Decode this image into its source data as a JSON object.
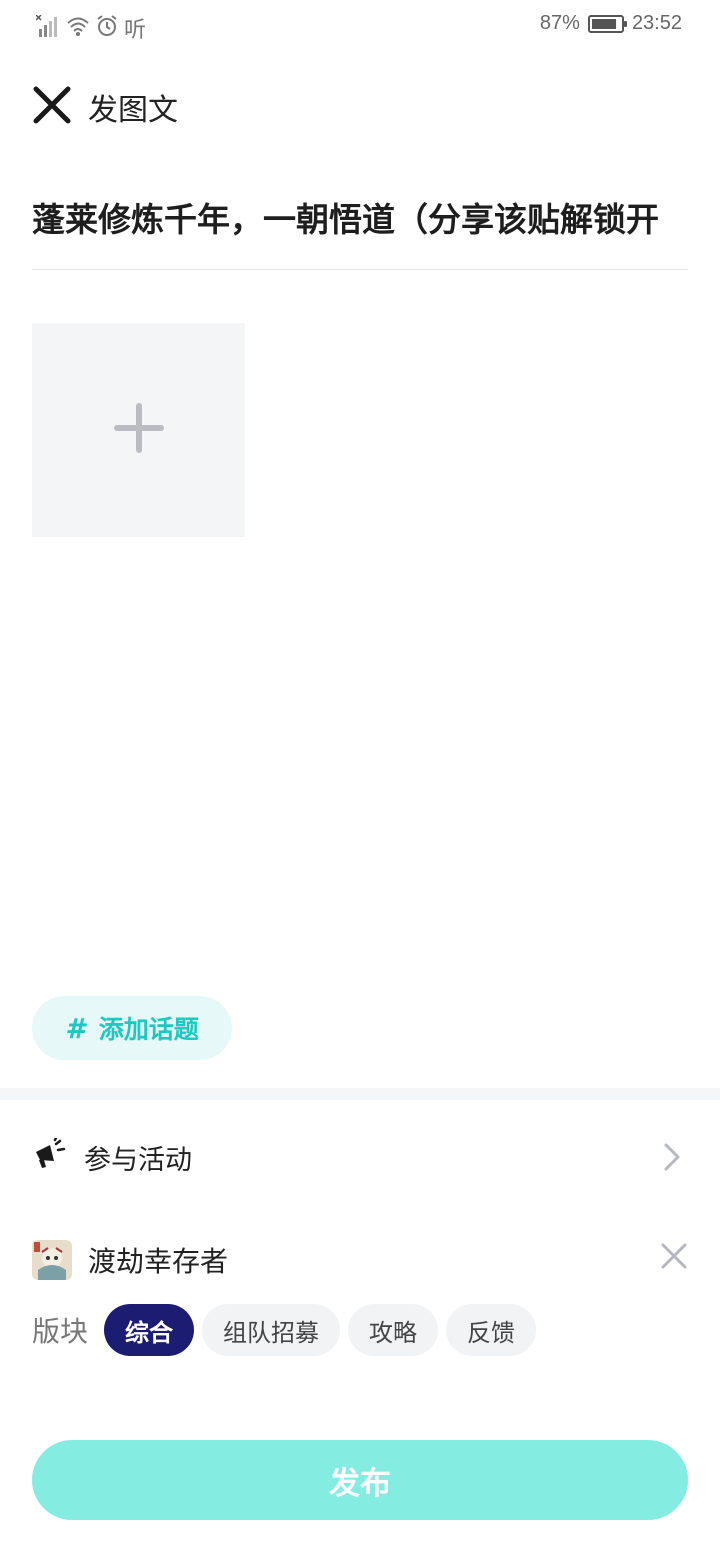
{
  "status_bar": {
    "battery_text": "87%",
    "battery_level": 0.87,
    "time": "23:52",
    "listen_text": "听",
    "icons": [
      "signal-icon",
      "wifi-icon",
      "alarm-icon"
    ]
  },
  "header": {
    "title": "发图文",
    "close_icon": "close-icon"
  },
  "post": {
    "title": "蓬莱修炼千年，一朝悟道（分享该贴解锁开"
  },
  "image_picker": {
    "icon": "plus-icon"
  },
  "topic": {
    "hash": "#",
    "label": "添加话题"
  },
  "activity": {
    "label": "参与活动",
    "icon": "megaphone-icon"
  },
  "game": {
    "name": "渡劫幸存者",
    "icon": "game-avatar"
  },
  "board": {
    "label": "版块",
    "options": [
      "综合",
      "组队招募",
      "攻略",
      "反馈"
    ],
    "selected": "综合"
  },
  "publish": {
    "label": "发布"
  },
  "colors": {
    "accent": "#1ec8c0",
    "publish_bg": "#85ece2",
    "chip_active": "#1c1c73",
    "chip_bg": "#f2f3f5"
  }
}
